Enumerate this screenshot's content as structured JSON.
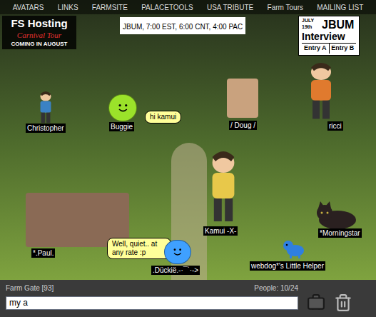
{
  "nav": {
    "items": [
      "AVATARS",
      "LINKS",
      "FARMSITE",
      "PALACETOOLS",
      "USA TRIBUTE",
      "Farm Tours",
      "MAILING LIST"
    ]
  },
  "room": {
    "notice": "JBUM, 7:00 EST, 6:00 CNT, 4:00 PAC",
    "promo": {
      "title": "FS Hosting",
      "subtitle": "Carnival Tour",
      "footer": "COMING IN AUGUST"
    },
    "interview": {
      "date": "JULY 19th",
      "title": "JBUM",
      "subtitle": "Interview",
      "entries": [
        "Entry A",
        "Entry B"
      ]
    },
    "users": [
      {
        "name": "Christopher",
        "kind": "figure",
        "color": "#3b82c4",
        "balloon": null
      },
      {
        "name": "Buggie",
        "kind": "smiley",
        "color": "#9be22a",
        "balloon": "hi kamui"
      },
      {
        "name": "/ Doug /",
        "kind": "photo",
        "color": "#c9a27e",
        "balloon": null
      },
      {
        "name": "ricci",
        "kind": "figure",
        "color": "#e07a2e",
        "balloon": null
      },
      {
        "name": "Kamui -X-",
        "kind": "figure",
        "color": "#e8c84a",
        "balloon": null
      },
      {
        "name": "*Morningstar",
        "kind": "cat",
        "color": "#2a2020",
        "balloon": null
      },
      {
        "name": "*.Paul.",
        "kind": "photo",
        "color": "#8a6a55",
        "balloon": "Well, quiet.. at any rate :p"
      },
      {
        "name": ".Dückië.-·¯`·->",
        "kind": "smiley",
        "color": "#3fa0ff",
        "balloon": null
      },
      {
        "name": "webdog*'s Little Helper",
        "kind": "dog",
        "color": "#2f7fe0",
        "balloon": null
      }
    ]
  },
  "status_bar": {
    "room": "Farm Gate [93]",
    "people": "People: 10/24"
  },
  "input": {
    "value": "my a"
  }
}
